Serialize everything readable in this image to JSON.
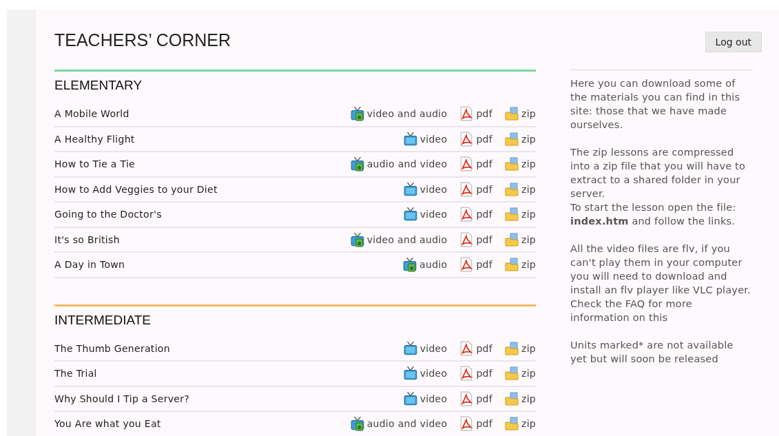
{
  "page": {
    "title": "TEACHERS’ CORNER",
    "logout": "Log out"
  },
  "sections": [
    {
      "heading": "ELEMENTARY",
      "color": "#7fd6a0",
      "lessons": [
        {
          "title": "A Mobile World",
          "media": {
            "kind": "av",
            "label": "video and audio"
          },
          "pdf": "pdf",
          "zip": "zip"
        },
        {
          "title": "A Healthy Flight",
          "media": {
            "kind": "video",
            "label": "video"
          },
          "pdf": "pdf",
          "zip": "zip"
        },
        {
          "title": "How to Tie a Tie",
          "media": {
            "kind": "av",
            "label": "audio and video"
          },
          "pdf": "pdf",
          "zip": "zip"
        },
        {
          "title": "How to Add Veggies to your Diet",
          "media": {
            "kind": "video",
            "label": "video"
          },
          "pdf": "pdf",
          "zip": "zip"
        },
        {
          "title": "Going to the Doctor's",
          "media": {
            "kind": "video",
            "label": "video"
          },
          "pdf": "pdf",
          "zip": "zip"
        },
        {
          "title": "It's so British",
          "media": {
            "kind": "av",
            "label": "video and audio"
          },
          "pdf": "pdf",
          "zip": "zip"
        },
        {
          "title": "A Day in Town",
          "media": {
            "kind": "av",
            "label": "audio"
          },
          "pdf": "pdf",
          "zip": "zip"
        }
      ]
    },
    {
      "heading": "INTERMEDIATE",
      "color": "#f5b866",
      "lessons": [
        {
          "title": "The Thumb Generation",
          "media": {
            "kind": "video",
            "label": "video"
          },
          "pdf": "pdf",
          "zip": "zip"
        },
        {
          "title": "The Trial",
          "media": {
            "kind": "video",
            "label": "video"
          },
          "pdf": "pdf",
          "zip": "zip"
        },
        {
          "title": "Why Should I Tip a Server?",
          "media": {
            "kind": "video",
            "label": "video"
          },
          "pdf": "pdf",
          "zip": "zip"
        },
        {
          "title": "You Are what you Eat",
          "media": {
            "kind": "av",
            "label": "audio and video"
          },
          "pdf": "pdf",
          "zip": "zip"
        }
      ]
    }
  ],
  "sidebar": {
    "paragraphs": [
      "Here you can download some of the materials you can find in this site: those that we have made ourselves.",
      "The zip lessons are compressed into a zip file that you will have to extract to a shared folder in your server.\nTo start the lesson open the file: **index.htm** and follow the links.",
      "All the video files are flv, if you can't play them in your computer you will need to download and install an flv player like VLC player. Check the FAQ for more information on this",
      "Units marked* are not available yet but will soon be released"
    ]
  }
}
